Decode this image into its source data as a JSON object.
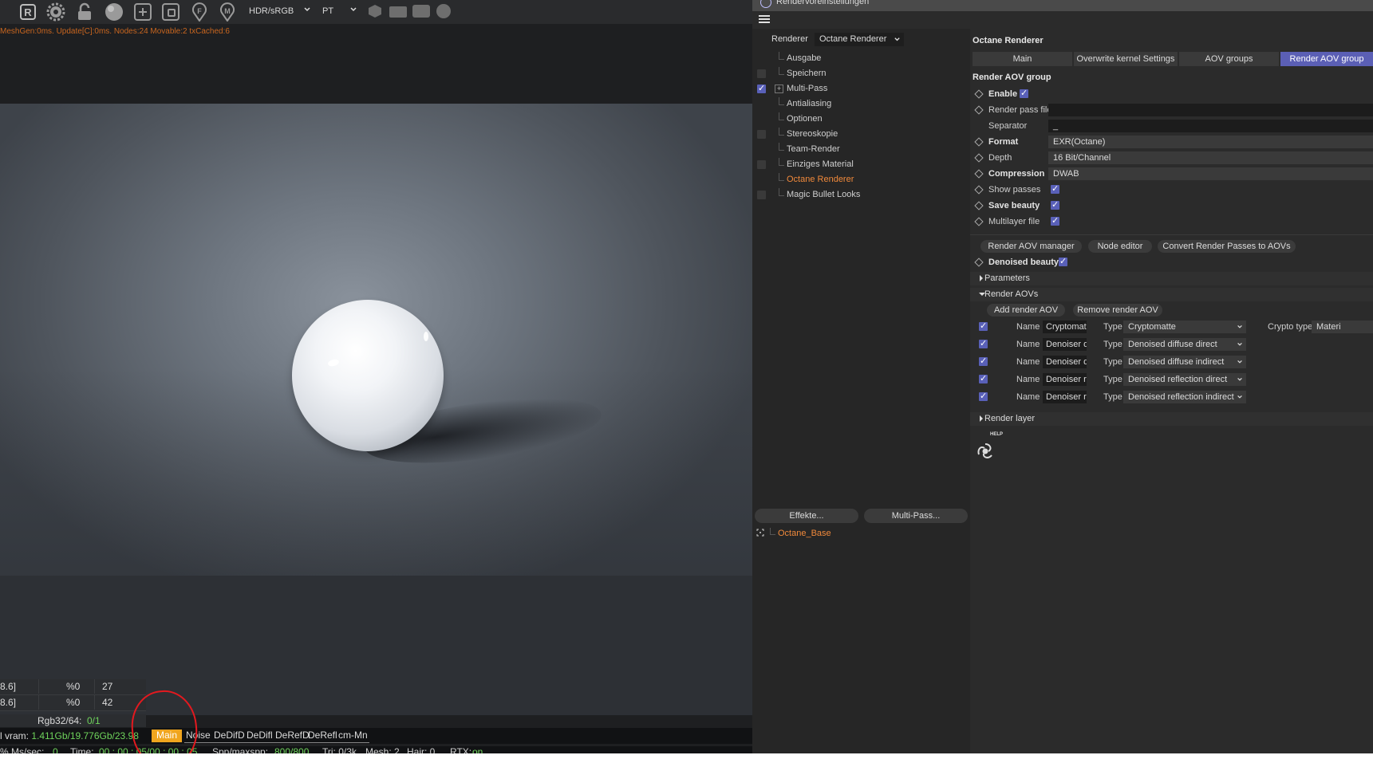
{
  "viewer": {
    "toolbar": {
      "icons": [
        "r-icon",
        "gear-icon",
        "lock-icon",
        "sphere-icon",
        "add-region-icon",
        "focus-icon",
        "f-pin-icon",
        "m-pin-icon"
      ],
      "color_space": "HDR/sRGB",
      "kernel": "PT"
    },
    "status_line": "MeshGen:0ms. Update[C]:0ms. Nodes:24 Movable:2 txCached:6",
    "stats_rows": [
      {
        "a": "8.6]",
        "b": "%0",
        "c": "27"
      },
      {
        "a": "8.6]",
        "b": "%0",
        "c": "42"
      }
    ],
    "rgb_label": "Rgb32/64:",
    "rgb_value": "0/1",
    "vram_label": "l vram:",
    "vram_value": "1.411Gb/19.776Gb/23.98",
    "passes": [
      "Main",
      "Noise",
      "DeDifD",
      "DeDifl",
      "DeRefD",
      "DeRefl",
      "cm-Mn"
    ],
    "active_pass": "Main",
    "timebar": {
      "prefix": "% Ms/sec:",
      "mssec": "0",
      "time_label": "Time:",
      "time": "00 : 00 : 05/00 : 00 : 05",
      "spp_label": "Spp/maxspp:",
      "spp": "800/800",
      "tri": "Tri: 0/3k",
      "mesh": "Mesh: 2",
      "hair": "Hair: 0",
      "rtx_label": "RTX:",
      "rtx": "on"
    },
    "colors": {
      "status_orange": "#c9661f",
      "active_pass": "#f0a51e",
      "value_green": "#6fd45c",
      "annotation_red": "#e3191f"
    }
  },
  "render_settings": {
    "window_title": "Rendervoreinstellungen",
    "renderer_label": "Renderer",
    "renderer_value": "Octane Renderer",
    "tree": [
      {
        "label": "Ausgabe",
        "checkbox": false,
        "checked": false
      },
      {
        "label": "Speichern",
        "checkbox": true,
        "checked": false
      },
      {
        "label": "Multi-Pass",
        "checkbox": true,
        "checked": true,
        "expandable": true
      },
      {
        "label": "Antialiasing",
        "checkbox": false,
        "checked": false
      },
      {
        "label": "Optionen",
        "checkbox": false,
        "checked": false
      },
      {
        "label": "Stereoskopie",
        "checkbox": true,
        "checked": false
      },
      {
        "label": "Team-Render",
        "checkbox": false,
        "checked": false
      },
      {
        "label": "Einziges Material",
        "checkbox": true,
        "checked": false
      },
      {
        "label": "Octane Renderer",
        "checkbox": false,
        "checked": false,
        "selected": true
      },
      {
        "label": "Magic Bullet Looks",
        "checkbox": true,
        "checked": false
      }
    ],
    "effects_button": "Effekte...",
    "multipass_button": "Multi-Pass...",
    "preset": "Octane_Base",
    "panel_title": "Octane Renderer",
    "tabs": [
      "Main",
      "Overwrite kernel Settings",
      "AOV groups",
      "Render AOV group"
    ],
    "active_tab": "Render AOV group",
    "group_title": "Render AOV group",
    "params": {
      "enable": "Enable",
      "render_pass_file": "Render pass file",
      "render_pass_file_value": "",
      "separator": "Separator",
      "separator_value": "_",
      "format": "Format",
      "format_value": "EXR(Octane)",
      "depth": "Depth",
      "depth_value": "16 Bit/Channel",
      "compression": "Compression",
      "compression_value": "DWAB",
      "show_passes": "Show passes",
      "save_beauty": "Save beauty",
      "multilayer_file": "Multilayer file"
    },
    "buttons": {
      "aov_manager": "Render AOV manager",
      "node_editor": "Node editor",
      "convert": "Convert Render Passes to AOVs",
      "add_aov": "Add render AOV",
      "remove_aov": "Remove render AOV"
    },
    "denoised_beauty": "Denoised beauty",
    "sections": {
      "parameters": "Parameters",
      "render_aovs": "Render AOVs",
      "render_layer": "Render layer"
    },
    "aov_name_label": "Name",
    "aov_type_label": "Type",
    "crypto_type_label": "Crypto type",
    "crypto_type_value": "Materi",
    "aovs": [
      {
        "name": "Cryptomat",
        "type": "Cryptomatte"
      },
      {
        "name": "Denoiser d",
        "type": "Denoised diffuse direct"
      },
      {
        "name": "Denoiser d",
        "type": "Denoised diffuse indirect"
      },
      {
        "name": "Denoiser r",
        "type": "Denoised reflection direct"
      },
      {
        "name": "Denoiser r",
        "type": "Denoised reflection indirect"
      }
    ],
    "help_label": "HELP",
    "colors": {
      "accent": "#5b5fb5",
      "selected_text": "#f0893b",
      "background": "#2b2b2b"
    }
  }
}
